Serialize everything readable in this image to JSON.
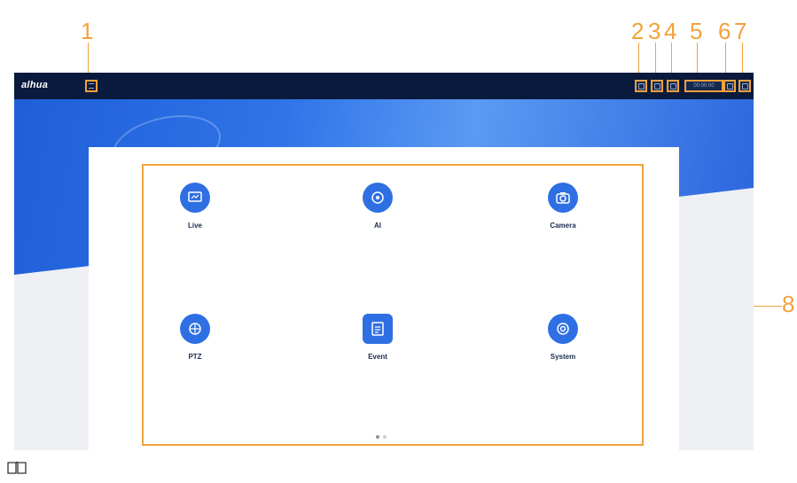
{
  "callouts": [
    "1",
    "2",
    "3",
    "4",
    "5",
    "6",
    "7",
    "8"
  ],
  "topbar": {
    "brand": "alhua",
    "time_text": "00:00:00",
    "icons": [
      "expand-icon",
      "user-icon",
      "lock-icon",
      "time-display",
      "notification-icon",
      "logout-icon"
    ]
  },
  "tiles": [
    {
      "title": "Live",
      "sub1": "",
      "sub2": "",
      "icon": "live-icon",
      "color": "#2f6fe4"
    },
    {
      "title": "AI",
      "sub1": "",
      "sub2": "",
      "icon": "ai-icon",
      "color": "#2f6fe4"
    },
    {
      "title": "Camera",
      "sub1": "",
      "sub2": "",
      "icon": "camera-icon",
      "color": "#2f6fe4"
    },
    {
      "title": "PTZ",
      "sub1": "",
      "sub2": "",
      "icon": "ptz-icon",
      "color": "#2f6fe4"
    },
    {
      "title": "Event",
      "sub1": "",
      "sub2": "",
      "icon": "event-icon",
      "color": "#2f6fe4"
    },
    {
      "title": "System",
      "sub1": "",
      "sub2": "",
      "icon": "system-icon",
      "color": "#2f6fe4"
    }
  ],
  "pagination": {
    "pages": 2,
    "current": 1
  },
  "colors": {
    "callout": "#f2a23c",
    "topbar": "#0a1a3d",
    "accent": "#2f6fe4"
  }
}
